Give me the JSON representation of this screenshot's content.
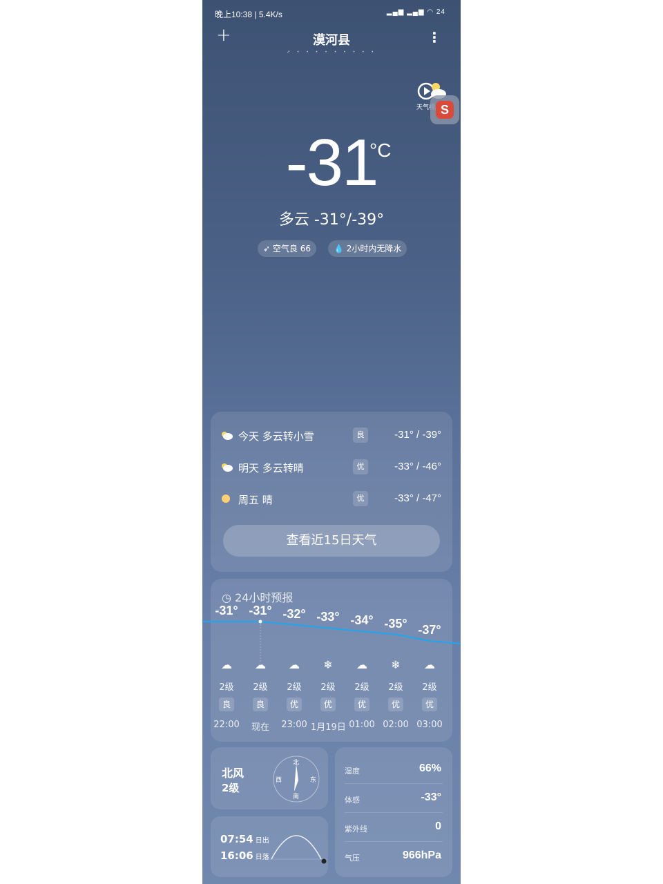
{
  "status_bar": {
    "left": "晚上10:38 | 5.4K/s",
    "right": "▂▄▆ ▂▄▆ ◠ 24"
  },
  "header": {
    "plus_label": "+",
    "city": "漠河县",
    "pager_dots": "➚ • • • • • • • • •",
    "more_label": "⋮"
  },
  "video_widget": {
    "label": "天气视频"
  },
  "float_ball": {
    "label": "S"
  },
  "current": {
    "temp": "-31",
    "unit": "°C",
    "summary": "多云  -31°/-39°",
    "air_quality": "空气良 66",
    "precip": "2小时内无降水"
  },
  "daily": [
    {
      "label": "今天  多云转小雪",
      "aq": "良",
      "range": "-31° / -39°",
      "icon": "cloudy-icon"
    },
    {
      "label": "明天  多云转晴",
      "aq": "优",
      "range": "-33° / -46°",
      "icon": "cloudy-icon"
    },
    {
      "label": "周五  晴",
      "aq": "优",
      "range": "-33° / -47°",
      "icon": "sun-icon"
    }
  ],
  "daily_button": "查看近15日天气",
  "hourly": {
    "title": "24小时预报",
    "items": [
      {
        "temp": "-31°",
        "icon": "☁",
        "wind": "2级",
        "aq": "良",
        "time": "22:00"
      },
      {
        "temp": "-31°",
        "icon": "☁",
        "wind": "2级",
        "aq": "良",
        "time": "现在"
      },
      {
        "temp": "-32°",
        "icon": "☁",
        "wind": "2级",
        "aq": "优",
        "time": "23:00"
      },
      {
        "temp": "-33°",
        "icon": "❄",
        "wind": "2级",
        "aq": "优",
        "time": "1月19日"
      },
      {
        "temp": "-34°",
        "icon": "☁",
        "wind": "2级",
        "aq": "优",
        "time": "01:00"
      },
      {
        "temp": "-35°",
        "icon": "❄",
        "wind": "2级",
        "aq": "优",
        "time": "02:00"
      },
      {
        "temp": "-37°",
        "icon": "☁",
        "wind": "2级",
        "aq": "优",
        "time": "03:00"
      }
    ],
    "values": [
      -31,
      -31,
      -32,
      -33,
      -34,
      -35,
      -37
    ]
  },
  "wind": {
    "direction": "北风",
    "level": "2级",
    "compass": {
      "n": "北",
      "s": "南",
      "e": "东",
      "w": "西"
    }
  },
  "sun": {
    "sunrise": "07:54",
    "sunrise_label": "日出",
    "sunset": "16:06",
    "sunset_label": "日落"
  },
  "details": [
    {
      "label": "湿度",
      "value": "66%"
    },
    {
      "label": "体感",
      "value": "-33°"
    },
    {
      "label": "紫外线",
      "value": "0"
    },
    {
      "label": "气压",
      "value": "966hPa"
    }
  ],
  "colors": {
    "accent_line": "#1fa6f0"
  }
}
